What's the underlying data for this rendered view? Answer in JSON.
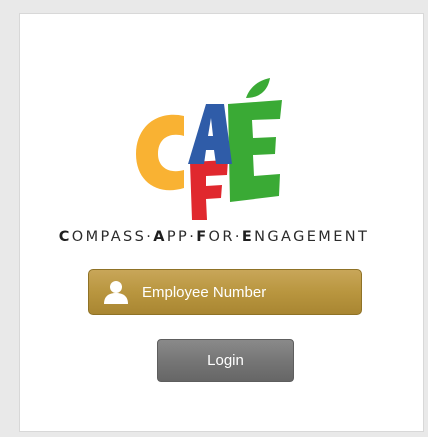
{
  "logo": {
    "letters": [
      "C",
      "A",
      "F",
      "E"
    ],
    "colors": {
      "c": "#f9b233",
      "a": "#2f5ca8",
      "f": "#e0282e",
      "e": "#3aaa35",
      "leaf": "#3aaa35"
    }
  },
  "tagline": {
    "segments": [
      {
        "cap": "C",
        "rest": "OMPASS"
      },
      {
        "sep": "·"
      },
      {
        "cap": "A",
        "rest": "PP"
      },
      {
        "sep": "·"
      },
      {
        "cap": "F",
        "rest": "OR"
      },
      {
        "sep": "·"
      },
      {
        "cap": "E",
        "rest": "NGAGEMENT"
      }
    ]
  },
  "login_form": {
    "employee_number": {
      "value": "",
      "placeholder": "Employee Number",
      "icon": "user-icon"
    },
    "login_label": "Login"
  },
  "colors": {
    "field_gold": "#b9963f",
    "button_gray": "#777777",
    "background": "#e9e9e9"
  }
}
